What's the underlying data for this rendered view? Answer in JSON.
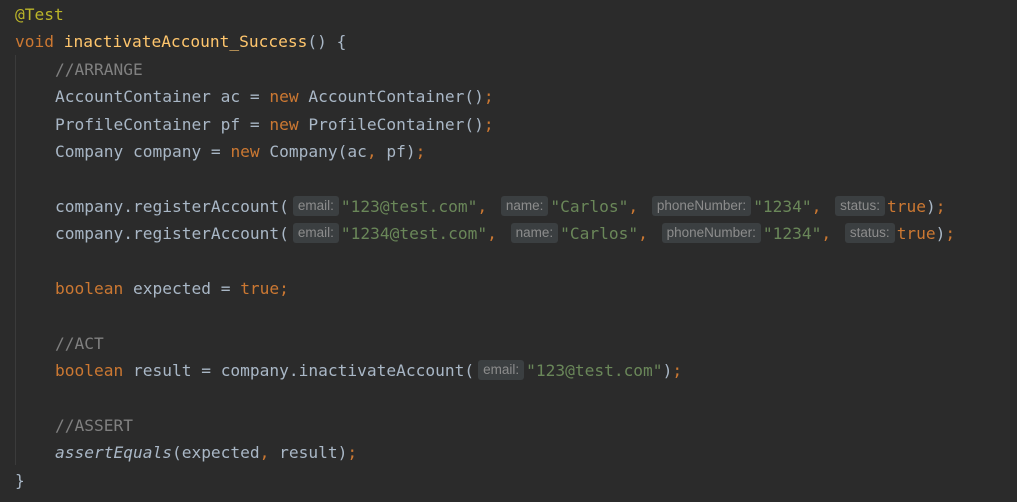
{
  "colors": {
    "background": "#2b2b2b",
    "text": "#a9b7c6",
    "keyword": "#cc7832",
    "string": "#6a8759",
    "comment": "#808080",
    "annotation": "#bbb529",
    "method_declaration": "#ffc66d",
    "hint_background": "#3b3f41",
    "hint_text": "#8c8c8c"
  },
  "code": {
    "annotation": "@Test",
    "decl": {
      "kw_void": "void",
      "method_name": "inactivateAccount_Success",
      "tail": "() {"
    },
    "arrange": {
      "comment": "//ARRANGE",
      "l1": {
        "a": "AccountContainer ac = ",
        "kw": "new",
        "b": " AccountContainer()",
        "semi": ";"
      },
      "l2": {
        "a": "ProfileContainer pf = ",
        "kw": "new",
        "b": " ProfileContainer()",
        "semi": ";"
      },
      "l3": {
        "a": "Company company = ",
        "kw": "new",
        "b": " Company(ac",
        "comma": ",",
        "c": " pf)",
        "semi": ";"
      },
      "reg1": {
        "call": "company.registerAccount(",
        "hint_email": "email:",
        "v_email": "\"123@test.com\"",
        "c1": ",",
        "hint_name": "name:",
        "v_name": "\"Carlos\"",
        "c2": ",",
        "hint_phone": "phoneNumber:",
        "v_phone": "\"1234\"",
        "c3": ",",
        "hint_status": "status:",
        "v_status": "true",
        "close": ")",
        "semi": ";"
      },
      "reg2": {
        "call": "company.registerAccount(",
        "hint_email": "email:",
        "v_email": "\"1234@test.com\"",
        "c1": ",",
        "hint_name": "name:",
        "v_name": "\"Carlos\"",
        "c2": ",",
        "hint_phone": "phoneNumber:",
        "v_phone": "\"1234\"",
        "c3": ",",
        "hint_status": "status:",
        "v_status": "true",
        "close": ")",
        "semi": ";"
      },
      "expected": {
        "kw": "boolean",
        "a": " expected = ",
        "val": "true",
        "semi": ";"
      }
    },
    "act": {
      "comment": "//ACT",
      "kw": "boolean",
      "a": " result = company.inactivateAccount(",
      "hint_email": "email:",
      "v_email": "\"123@test.com\"",
      "close": ")",
      "semi": ";"
    },
    "assert": {
      "comment": "//ASSERT",
      "fn": "assertEquals",
      "a": "(expected",
      "comma": ",",
      "b": " result)",
      "semi": ";"
    },
    "closing_brace": "}"
  }
}
